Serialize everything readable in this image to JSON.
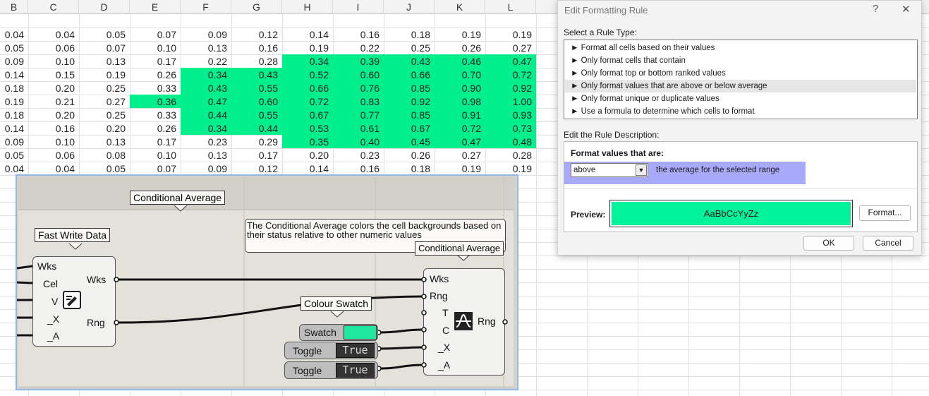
{
  "spreadsheet": {
    "columns": [
      "B",
      "C",
      "D",
      "E",
      "F",
      "G",
      "H",
      "I",
      "J",
      "K",
      "L"
    ],
    "rows": [
      [
        "0.04",
        "0.04",
        "0.05",
        "0.07",
        "0.09",
        "0.12",
        "0.14",
        "0.16",
        "0.18",
        "0.19",
        "0.19"
      ],
      [
        "0.05",
        "0.06",
        "0.07",
        "0.10",
        "0.13",
        "0.16",
        "0.19",
        "0.22",
        "0.25",
        "0.26",
        "0.27"
      ],
      [
        "0.09",
        "0.10",
        "0.13",
        "0.17",
        "0.22",
        "0.28",
        "0.34",
        "0.39",
        "0.43",
        "0.46",
        "0.47"
      ],
      [
        "0.14",
        "0.15",
        "0.19",
        "0.26",
        "0.34",
        "0.43",
        "0.52",
        "0.60",
        "0.66",
        "0.70",
        "0.72"
      ],
      [
        "0.18",
        "0.20",
        "0.25",
        "0.33",
        "0.43",
        "0.55",
        "0.66",
        "0.76",
        "0.85",
        "0.90",
        "0.92"
      ],
      [
        "0.19",
        "0.21",
        "0.27",
        "0.36",
        "0.47",
        "0.60",
        "0.72",
        "0.83",
        "0.92",
        "0.98",
        "1.00"
      ],
      [
        "0.18",
        "0.20",
        "0.25",
        "0.33",
        "0.44",
        "0.55",
        "0.67",
        "0.77",
        "0.85",
        "0.91",
        "0.93"
      ],
      [
        "0.14",
        "0.16",
        "0.20",
        "0.26",
        "0.34",
        "0.44",
        "0.53",
        "0.61",
        "0.67",
        "0.72",
        "0.73"
      ],
      [
        "0.09",
        "0.10",
        "0.13",
        "0.17",
        "0.23",
        "0.29",
        "0.35",
        "0.40",
        "0.45",
        "0.47",
        "0.48"
      ],
      [
        "0.05",
        "0.06",
        "0.08",
        "0.10",
        "0.13",
        "0.17",
        "0.20",
        "0.23",
        "0.26",
        "0.27",
        "0.28"
      ],
      [
        "0.04",
        "0.04",
        "0.05",
        "0.07",
        "0.09",
        "0.12",
        "0.14",
        "0.16",
        "0.18",
        "0.19",
        "0.19"
      ]
    ],
    "highlight_color": "#00ee8c"
  },
  "grasshopper": {
    "group_conditional_average": "Conditional Average",
    "group_fast_write": "Fast Write Data",
    "group_colour_swatch": "Colour Swatch",
    "note_text": "The Conditional Average colors the cell backgrounds based on their status relative to other numeric values",
    "note_overlay_label": "Conditional Average",
    "fast_write": {
      "inputs": [
        "Wks",
        "Cel",
        "V",
        "_X",
        "_A"
      ],
      "outputs": [
        "Wks",
        "Rng"
      ]
    },
    "cond_avg": {
      "inputs": [
        "Wks",
        "Rng",
        "T",
        "C",
        "_X",
        "_A"
      ],
      "outputs": [
        "Rng"
      ]
    },
    "swatch_label": "Swatch",
    "swatch_color": "#1ee8a0",
    "toggle1_label": "Toggle",
    "toggle1_value": "True",
    "toggle2_label": "Toggle",
    "toggle2_value": "True"
  },
  "dialog": {
    "title": "Edit Formatting Rule",
    "help_icon": "?",
    "close_icon": "✕",
    "select_rule_type_label": "Select a Rule Type:",
    "rule_types": [
      "► Format all cells based on their values",
      "► Only format cells that contain",
      "► Only format top or bottom ranked values",
      "► Only format values that are above or below average",
      "► Only format unique or duplicate values",
      "► Use a formula to determine which cells to format"
    ],
    "selected_rule_index": 3,
    "edit_description_label": "Edit the Rule Description:",
    "format_values_label": "Format values that are:",
    "combo_value": "above",
    "combo_suffix": "the average for the selected range",
    "preview_label": "Preview:",
    "preview_text": "AaBbCcYyZz",
    "preview_color": "#00f29b",
    "format_button": "Format...",
    "ok_button": "OK",
    "cancel_button": "Cancel"
  }
}
